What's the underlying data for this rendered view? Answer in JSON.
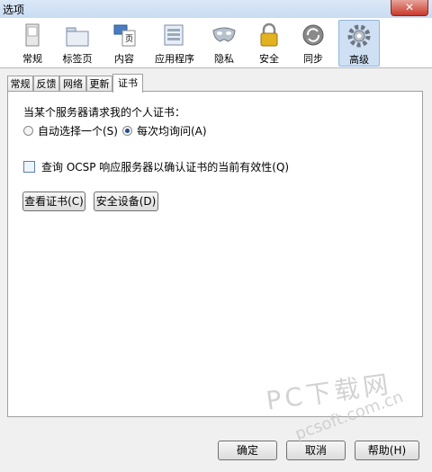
{
  "window": {
    "title": "选项",
    "close_glyph": "✕"
  },
  "toolbar": {
    "items": [
      {
        "label": "常规",
        "icon": "general-icon"
      },
      {
        "label": "标签页",
        "icon": "tabs-icon"
      },
      {
        "label": "内容",
        "icon": "content-icon"
      },
      {
        "label": "应用程序",
        "icon": "applications-icon"
      },
      {
        "label": "隐私",
        "icon": "privacy-mask-icon"
      },
      {
        "label": "安全",
        "icon": "lock-icon"
      },
      {
        "label": "同步",
        "icon": "sync-icon"
      },
      {
        "label": "高级",
        "icon": "gear-icon",
        "active": true
      }
    ]
  },
  "subtabs": [
    "常规",
    "反馈",
    "网络",
    "更新",
    "证书"
  ],
  "certificates": {
    "question": "当某个服务器请求我的个人证书：",
    "radio_auto": "自动选择一个(S)",
    "radio_ask": "每次均询问(A)",
    "ocsp_label": "查询 OCSP 响应服务器以确认证书的当前有效性(Q)",
    "view_certs_button": "查看证书(C)",
    "security_devices_button": "安全设备(D)"
  },
  "footer": {
    "ok": "确定",
    "cancel": "取消",
    "help": "帮助(H)"
  },
  "watermark": {
    "line1": "PC下载网",
    "line2": "pcsoft.com.cn"
  }
}
